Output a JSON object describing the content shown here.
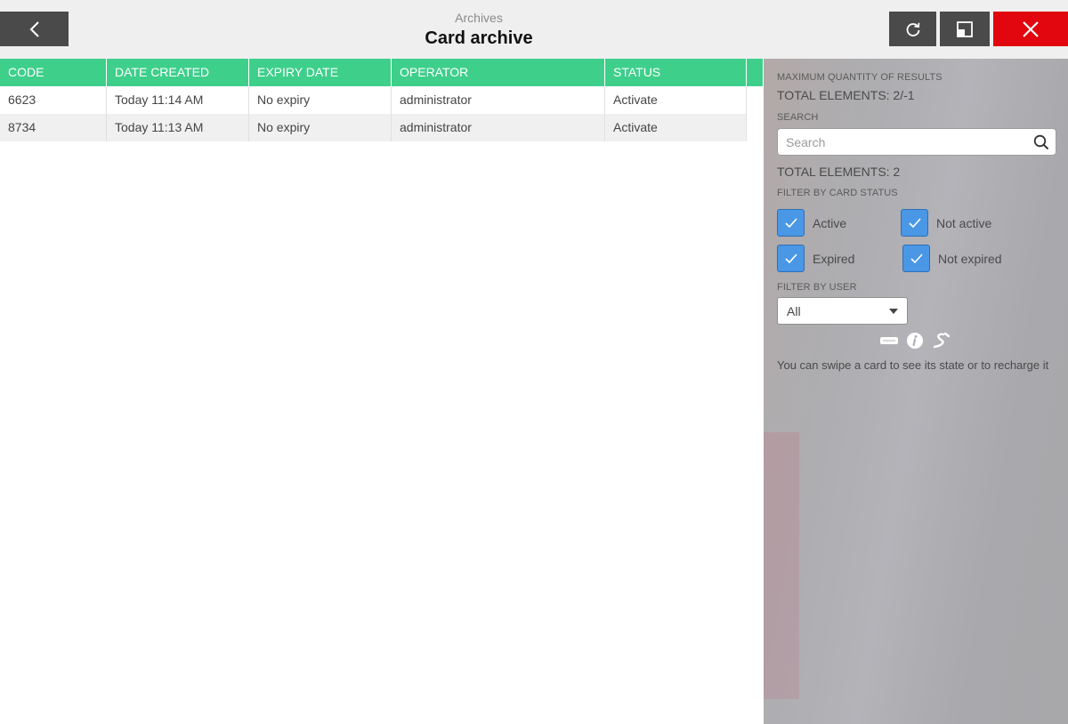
{
  "header": {
    "subtitle": "Archives",
    "title": "Card archive"
  },
  "table": {
    "columns": [
      "CODE",
      "DATE CREATED",
      "EXPIRY DATE",
      "OPERATOR",
      "STATUS"
    ],
    "rows": [
      {
        "code": "6623",
        "date_created": "Today 11:14 AM",
        "expiry_date": "No expiry",
        "operator": "administrator",
        "status": "Activate"
      },
      {
        "code": "8734",
        "date_created": "Today 11:13 AM",
        "expiry_date": "No expiry",
        "operator": "administrator",
        "status": "Activate"
      }
    ],
    "header_color": "#3ecf8b"
  },
  "sidebar": {
    "max_results_label": "MAXIMUM QUANTITY OF RESULTS",
    "total_elements_max": "TOTAL ELEMENTS: 2/-1",
    "search_label": "SEARCH",
    "search_placeholder": "Search",
    "search_value": "",
    "total_elements": "TOTAL ELEMENTS: 2",
    "filter_status_label": "FILTER BY CARD STATUS",
    "status_filters": [
      {
        "label": "Active",
        "checked": true
      },
      {
        "label": "Not active",
        "checked": true
      },
      {
        "label": "Expired",
        "checked": true
      },
      {
        "label": "Not expired",
        "checked": true
      }
    ],
    "filter_user_label": "FILTER BY USER",
    "user_selected": "All",
    "hint": "You can swipe a card to see its state or to recharge it",
    "icons": [
      "card-icon",
      "info-icon",
      "swipe-icon"
    ]
  },
  "colors": {
    "accent": "#3ecf8b",
    "close": "#e2060e",
    "dark_button": "#4a4a4a",
    "checkbox": "#4a97e6"
  }
}
